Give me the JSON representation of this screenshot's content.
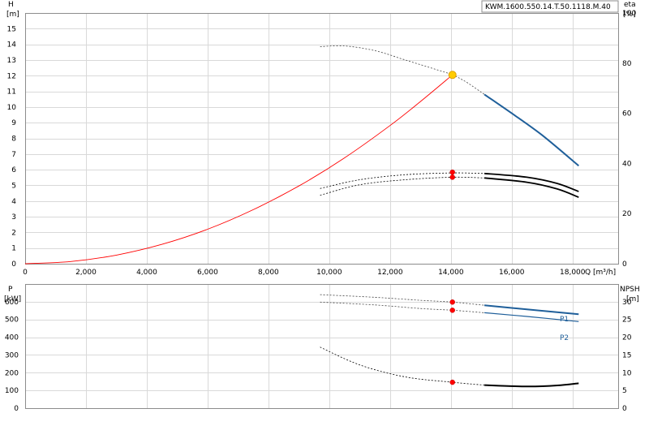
{
  "pump_id": "KWM.1600.550.14.T.50.1118.M.40",
  "colors": {
    "grid": "#d9d9d9",
    "frame": "#8c8c8c",
    "system_curve": "#ff0000",
    "head_curve": "#1f5f9a",
    "operating_point_fill": "#ffcc00",
    "operating_point_stroke": "#e0a000",
    "marker": "#ff0000",
    "efficiency_curve": "#000000",
    "npsh_curve": "#000000",
    "power_curve": "#1f5f9a"
  },
  "chart_data": [
    {
      "type": "line",
      "xlabel": "Q [m³/h]",
      "xlim": [
        0,
        19500
      ],
      "x_ticks": [
        0,
        2000,
        4000,
        6000,
        8000,
        10000,
        12000,
        14000,
        16000,
        18000
      ],
      "x_tick_labels": [
        "0",
        "2,000",
        "4,000",
        "6,000",
        "8,000",
        "10,000",
        "12,000",
        "14,000",
        "16,000",
        "18,000"
      ],
      "y_left": {
        "label": "H",
        "unit": "[m]",
        "ylim": [
          0,
          16
        ],
        "ticks": [
          0,
          1,
          2,
          3,
          4,
          5,
          6,
          7,
          8,
          9,
          10,
          11,
          12,
          13,
          14,
          15
        ]
      },
      "y_right": {
        "label": "eta",
        "unit": "[%]",
        "ylim": [
          0,
          100
        ],
        "ticks": [
          0,
          20,
          40,
          60,
          80,
          100
        ],
        "tick_labels": [
          "0",
          "20",
          "40",
          "60",
          "80",
          "100"
        ]
      },
      "grid": true,
      "series": [
        {
          "kind": "system_curve",
          "axis": "left",
          "x": [
            0,
            1500,
            3000,
            4500,
            6000,
            7500,
            9000,
            10500,
            12000,
            13000,
            14050
          ],
          "y": [
            0,
            0.14,
            0.55,
            1.24,
            2.2,
            3.45,
            4.96,
            6.75,
            8.82,
            10.35,
            12.05
          ]
        },
        {
          "kind": "head_curve_dashed",
          "axis": "left",
          "x": [
            9700,
            10500,
            11500,
            12500,
            13500,
            14050,
            14500,
            15100
          ],
          "y": [
            13.85,
            13.9,
            13.6,
            13.0,
            12.4,
            12.05,
            11.6,
            10.8
          ]
        },
        {
          "kind": "head_curve_solid",
          "axis": "left",
          "x": [
            15100,
            16000,
            17000,
            18200
          ],
          "y": [
            10.8,
            9.6,
            8.2,
            6.25
          ]
        },
        {
          "kind": "efficiency_upper",
          "axis": "right",
          "x": [
            9700,
            11000,
            12500,
            14050,
            15100,
            16500,
            17500,
            18200
          ],
          "y": [
            30,
            33.5,
            35.5,
            36.2,
            36,
            34.5,
            32,
            28.8
          ]
        },
        {
          "kind": "efficiency_lower",
          "axis": "right",
          "x": [
            9700,
            11000,
            12500,
            14050,
            15100,
            16500,
            17500,
            18200
          ],
          "y": [
            27.3,
            31.5,
            33.5,
            34.5,
            34.2,
            32.5,
            29.8,
            26.5
          ]
        }
      ],
      "operating_point": {
        "x": 14050,
        "y": 12.05
      },
      "markers": [
        {
          "x": 14050,
          "y": 36.5,
          "axis": "right"
        },
        {
          "x": 14050,
          "y": 34.5,
          "axis": "right"
        }
      ]
    },
    {
      "type": "line",
      "x_ticks": [
        0,
        2000,
        4000,
        6000,
        8000,
        10000,
        12000,
        14000,
        16000,
        18000
      ],
      "y_left": {
        "label": "P",
        "unit": "[kW]",
        "ylim": [
          0,
          700
        ],
        "ticks": [
          0,
          100,
          200,
          300,
          400,
          500,
          600
        ],
        "tick_labels": [
          "0",
          "100",
          "200",
          "300",
          "400",
          "500",
          "600"
        ]
      },
      "y_right": {
        "label": "NPSH",
        "unit": "[m]",
        "ylim": [
          0,
          35
        ],
        "ticks": [
          0,
          5,
          10,
          15,
          20,
          25,
          30
        ]
      },
      "grid": true,
      "series": [
        {
          "name": "P1",
          "axis": "left",
          "x": [
            9700,
            11500,
            13000,
            14050,
            15100,
            16500,
            18200
          ],
          "y": [
            640,
            625,
            608,
            598,
            580,
            557,
            530
          ]
        },
        {
          "name": "P2",
          "axis": "left",
          "x": [
            9700,
            11500,
            13000,
            14050,
            15100,
            16500,
            18200
          ],
          "y": [
            598,
            582,
            562,
            552,
            538,
            517,
            488
          ]
        },
        {
          "kind": "npsh_curve",
          "axis": "right",
          "x": [
            9700,
            11000,
            12500,
            14050,
            15100,
            16500,
            17500,
            18200
          ],
          "y": [
            17.2,
            12.2,
            8.8,
            7.3,
            6.5,
            6.1,
            6.4,
            7.0
          ]
        }
      ],
      "markers": [
        {
          "x": 14050,
          "y": 598,
          "axis": "left"
        },
        {
          "x": 14050,
          "y": 552,
          "axis": "left"
        },
        {
          "x": 14050,
          "y": 7.3,
          "axis": "right"
        }
      ]
    }
  ]
}
